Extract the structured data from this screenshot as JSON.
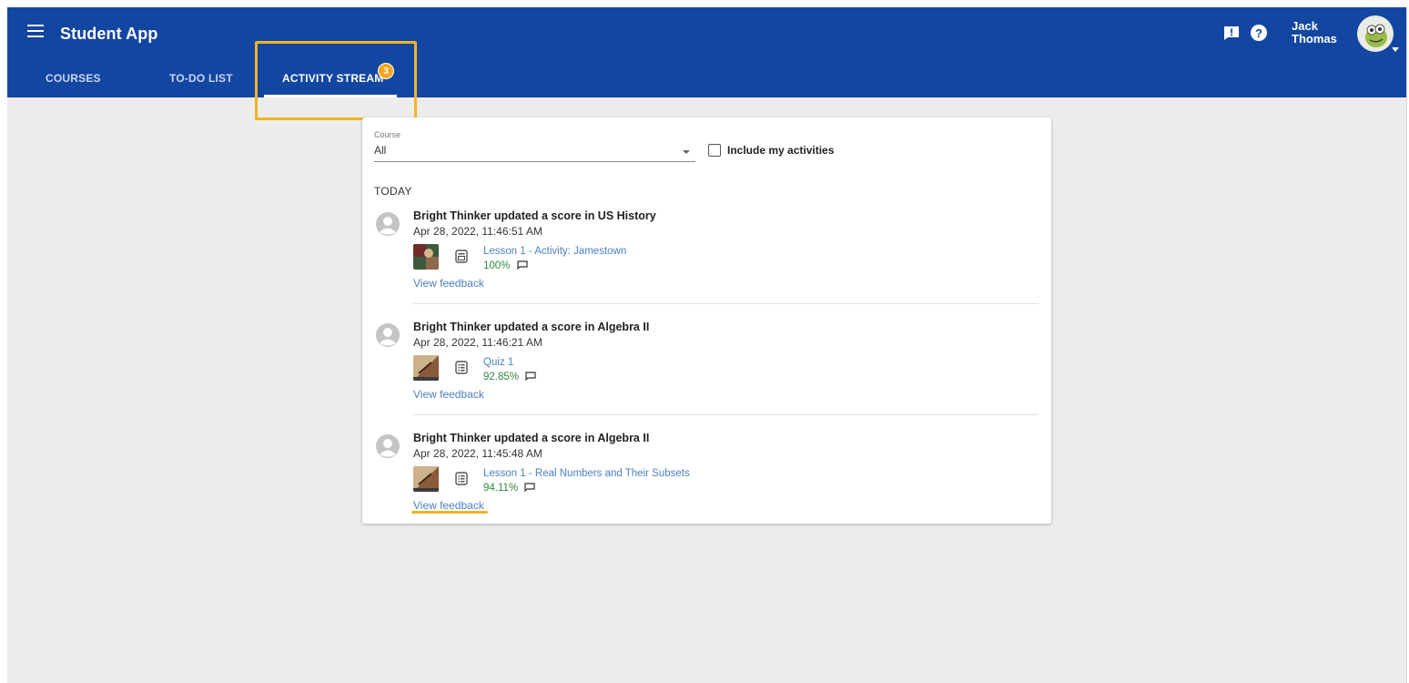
{
  "app": {
    "title": "Student App"
  },
  "tabs": [
    {
      "label": "COURSES",
      "active": false
    },
    {
      "label": "TO-DO LIST",
      "active": false
    },
    {
      "label": "ACTIVITY STREAM",
      "active": true,
      "badge": "3"
    }
  ],
  "header": {
    "user_name_first": "Jack",
    "user_name_last": "Thomas",
    "icons": [
      "feedback-icon",
      "help-icon"
    ],
    "help_glyph": "?"
  },
  "colors": {
    "appbar": "#1346a0",
    "badge": "#f4a71d",
    "highlight": "#f0b429",
    "link": "#4a7fc1",
    "score": "#2e8b3e"
  },
  "filter": {
    "course_label": "Course",
    "course_value": "All",
    "include_label": "Include my activities",
    "include_checked": false
  },
  "stream": {
    "section": "TODAY",
    "items": [
      {
        "title": "Bright Thinker updated a score in US History",
        "date": "Apr 28, 2022, 11:46:51 AM",
        "activity": "Lesson 1 - Activity: Jamestown",
        "score": "100%",
        "feedback": "View feedback",
        "icon": "document-icon"
      },
      {
        "title": "Bright Thinker updated a score in Algebra II",
        "date": "Apr 28, 2022, 11:46:21 AM",
        "activity": "Quiz 1",
        "score": "92.85%",
        "feedback": "View feedback",
        "icon": "list-icon"
      },
      {
        "title": "Bright Thinker updated a score in Algebra II",
        "date": "Apr 28, 2022, 11:45:48 AM",
        "activity": "Lesson 1 - Real Numbers and Their Subsets",
        "score": "94.11%",
        "feedback": "View feedback",
        "icon": "list-icon"
      }
    ]
  }
}
